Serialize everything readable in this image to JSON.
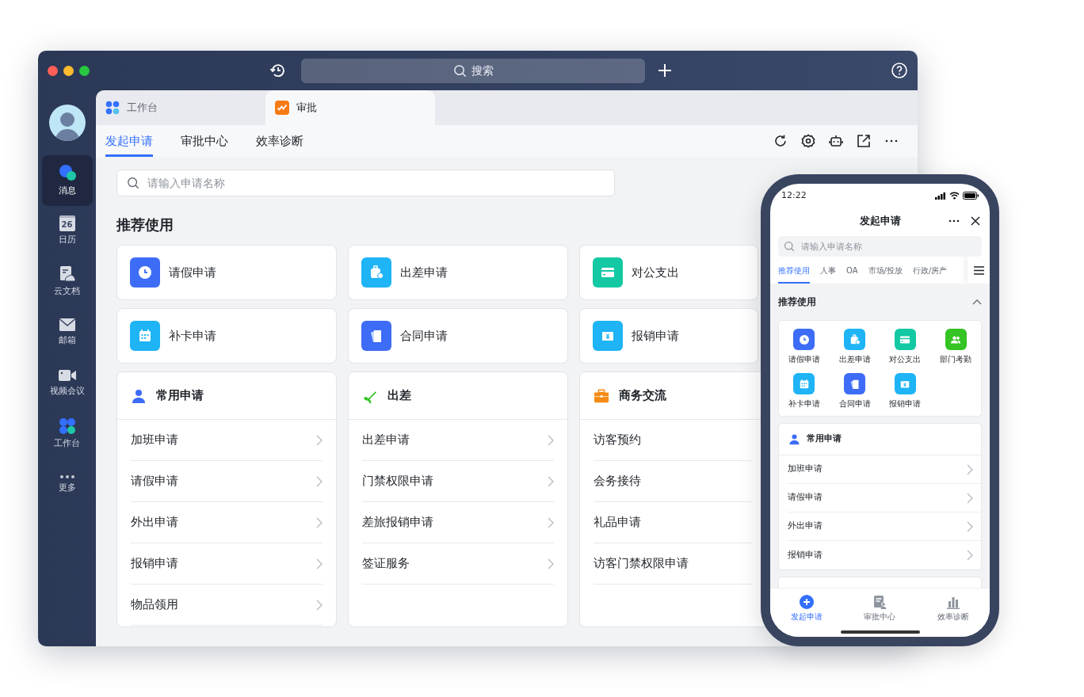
{
  "titlebar": {
    "search_placeholder": "搜索"
  },
  "sidebar": {
    "items": [
      {
        "label": "消息",
        "kind": "chat",
        "selected": true
      },
      {
        "label": "日历",
        "kind": "calendar",
        "icon_text": "26",
        "selected": false
      },
      {
        "label": "云文档",
        "kind": "doc",
        "selected": false
      },
      {
        "label": "邮箱",
        "kind": "mail",
        "selected": false
      },
      {
        "label": "视频会议",
        "kind": "video",
        "selected": false
      },
      {
        "label": "工作台",
        "kind": "grid",
        "selected": false
      },
      {
        "label": "更多",
        "kind": "dots",
        "selected": false
      }
    ]
  },
  "app_tabs": [
    {
      "label": "工作台",
      "kind": "grid",
      "selected": false
    },
    {
      "label": "审批",
      "kind": "approval",
      "selected": true
    }
  ],
  "nav_tabs": [
    {
      "label": "发起申请",
      "selected": true
    },
    {
      "label": "审批中心",
      "selected": false
    },
    {
      "label": "效率诊断",
      "selected": false
    }
  ],
  "search": {
    "placeholder": "请输入申请名称"
  },
  "recommended": {
    "title": "推荐使用",
    "items": [
      {
        "label": "请假申请",
        "kind": "clock",
        "color": "#3d6cf6"
      },
      {
        "label": "出差申请",
        "kind": "suitcase",
        "color": "#1eb4f5"
      },
      {
        "label": "对公支出",
        "kind": "card",
        "color": "#13c9a4"
      },
      {
        "label": "补卡申请",
        "kind": "calendar",
        "color": "#1eb4f5"
      },
      {
        "label": "合同申请",
        "kind": "contract",
        "color": "#3d6cf6"
      },
      {
        "label": "报销申请",
        "kind": "yen",
        "color": "#1eb4f5"
      }
    ]
  },
  "groups": [
    {
      "title": "常用申请",
      "kind": "person",
      "items": [
        "加班申请",
        "请假申请",
        "外出申请",
        "报销申请",
        "物品领用"
      ]
    },
    {
      "title": "出差",
      "kind": "plane",
      "items": [
        "出差申请",
        "门禁权限申请",
        "差旅报销申请",
        "签证服务"
      ]
    },
    {
      "title": "商务交流",
      "kind": "briefcase",
      "items": [
        "访客预约",
        "会务接待",
        "礼品申请",
        "访客门禁权限申请"
      ]
    }
  ],
  "phone": {
    "time": "12:22",
    "title": "发起申请",
    "search_placeholder": "请输入申请名称",
    "tabs": [
      {
        "label": "推荐使用",
        "selected": true
      },
      {
        "label": "人事",
        "selected": false
      },
      {
        "label": "OA",
        "selected": false
      },
      {
        "label": "市场/投放",
        "selected": false
      },
      {
        "label": "行政/房产",
        "selected": false
      }
    ],
    "section_title": "推荐使用",
    "grid": [
      {
        "label": "请假申请",
        "kind": "clock",
        "color": "#3d6cf6"
      },
      {
        "label": "出差申请",
        "kind": "suitcase",
        "color": "#1eb4f5"
      },
      {
        "label": "对公支出",
        "kind": "card",
        "color": "#13c9a4"
      },
      {
        "label": "部门考勤",
        "kind": "people",
        "color": "#35c424"
      },
      {
        "label": "补卡申请",
        "kind": "calendar",
        "color": "#1eb4f5"
      },
      {
        "label": "合同申请",
        "kind": "contract",
        "color": "#3d6cf6"
      },
      {
        "label": "报销申请",
        "kind": "yen",
        "color": "#1eb4f5"
      }
    ],
    "group": {
      "title": "常用申请",
      "kind": "person",
      "items": [
        "加班申请",
        "请假申请",
        "外出申请",
        "报销申请"
      ]
    },
    "bottom_tabs": [
      {
        "label": "发起申请",
        "kind": "plus",
        "selected": true
      },
      {
        "label": "审批中心",
        "kind": "approval-doc",
        "selected": false
      },
      {
        "label": "效率诊断",
        "kind": "bars",
        "selected": false
      }
    ]
  }
}
